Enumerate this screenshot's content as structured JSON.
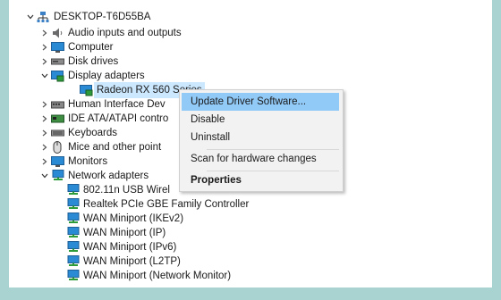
{
  "tree": {
    "root": "DESKTOP-T6D55BA",
    "categories": [
      {
        "label": "Audio inputs and outputs",
        "icon": "speaker-icon"
      },
      {
        "label": "Computer",
        "icon": "monitor-icon"
      },
      {
        "label": "Disk drives",
        "icon": "disk-drive-icon"
      },
      {
        "label": "Display adapters",
        "icon": "display-adapter-icon"
      },
      {
        "label": "Radeon RX 560 Series",
        "icon": "display-adapter-icon"
      },
      {
        "label": "Human Interface Dev",
        "icon": "hid-icon"
      },
      {
        "label": "IDE ATA/ATAPI contro",
        "icon": "ide-controller-icon"
      },
      {
        "label": "Keyboards",
        "icon": "keyboard-icon"
      },
      {
        "label": "Mice and other point",
        "icon": "mouse-icon"
      },
      {
        "label": "Monitors",
        "icon": "monitor-icon"
      },
      {
        "label": "Network adapters",
        "icon": "network-adapter-icon"
      },
      {
        "label": "802.11n USB Wirel",
        "icon": "network-adapter-icon"
      },
      {
        "label": "Realtek PCIe GBE Family Controller",
        "icon": "network-adapter-icon"
      },
      {
        "label": "WAN Miniport (IKEv2)",
        "icon": "network-adapter-icon"
      },
      {
        "label": "WAN Miniport (IP)",
        "icon": "network-adapter-icon"
      },
      {
        "label": "WAN Miniport (IPv6)",
        "icon": "network-adapter-icon"
      },
      {
        "label": "WAN Miniport (L2TP)",
        "icon": "network-adapter-icon"
      },
      {
        "label": "WAN Miniport (Network Monitor)",
        "icon": "network-adapter-icon"
      }
    ]
  },
  "context_menu": {
    "items": [
      "Update Driver Software...",
      "Disable",
      "Uninstall",
      "Scan for hardware changes",
      "Properties"
    ]
  },
  "colors": {
    "background": "#a9d3d0",
    "highlight": "#91c9f7",
    "selection": "#cce8ff"
  }
}
